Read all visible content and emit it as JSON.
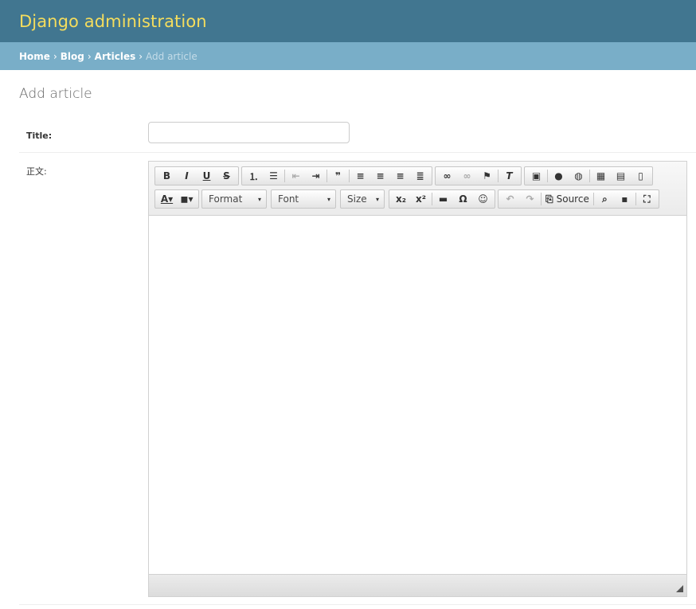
{
  "header": {
    "brand": "Django administration"
  },
  "breadcrumbs": {
    "home": "Home",
    "app": "Blog",
    "model": "Articles",
    "current": "Add article",
    "sep": "›"
  },
  "page": {
    "title": "Add article"
  },
  "form": {
    "title_label": "Title:",
    "title_value": "",
    "body_label": "正文:"
  },
  "editor": {
    "row1": [
      [
        "bold-icon",
        "italic-icon",
        "underline-icon",
        "strikethrough-icon"
      ],
      [
        "numbered-list-icon",
        "bulleted-list-icon",
        "|",
        "decrease-indent-icon",
        "increase-indent-icon",
        "|",
        "blockquote-icon",
        "|",
        "align-left-icon",
        "align-center-icon",
        "align-right-icon",
        "justify-icon"
      ],
      [
        "link-icon",
        "unlink-icon",
        "anchor-icon",
        "|",
        "remove-format-icon"
      ],
      [
        "image-icon",
        "flash-icon",
        "iframe-icon",
        "|",
        "table-icon",
        "form-icon",
        "document-icon"
      ]
    ],
    "combos": {
      "format": "Format",
      "font": "Font",
      "size": "Size"
    },
    "source_label": "Source"
  }
}
